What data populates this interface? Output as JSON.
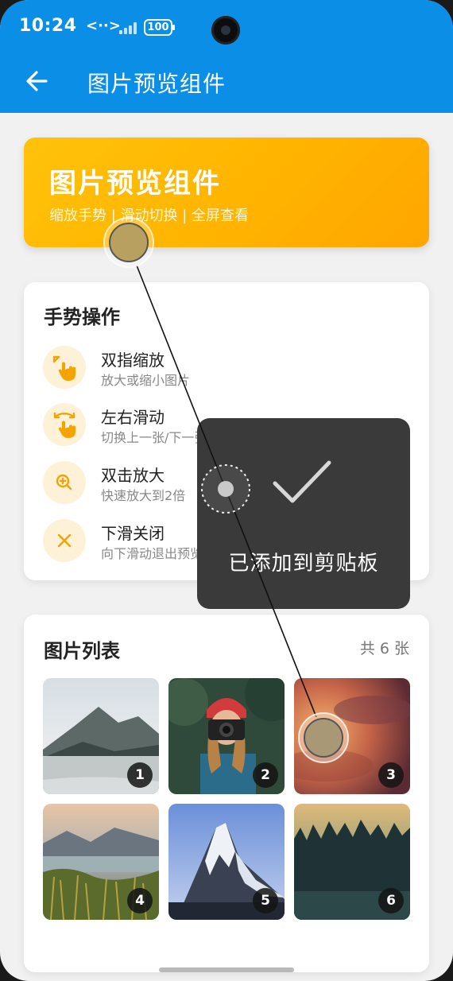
{
  "status_bar": {
    "time": "10:24",
    "network": "<··>",
    "battery": "100"
  },
  "app_bar": {
    "back_icon": "arrow-left-icon",
    "title": "图片预览组件"
  },
  "banner": {
    "title": "图片预览组件",
    "subtitle": "缩放手势 | 滑动切换 | 全屏查看"
  },
  "gestures": {
    "title": "手势操作",
    "items": [
      {
        "icon": "pinch-zoom-icon",
        "name": "双指缩放",
        "desc": "放大或缩小图片"
      },
      {
        "icon": "swipe-icon",
        "name": "左右滑动",
        "desc": "切换上一张/下一张"
      },
      {
        "icon": "zoom-in-icon",
        "name": "双击放大",
        "desc": "快速放大到2倍"
      },
      {
        "icon": "close-icon",
        "name": "下滑关闭",
        "desc": "向下滑动退出预览"
      }
    ]
  },
  "image_list": {
    "title": "图片列表",
    "count": "共 6 张",
    "images": [
      {
        "index": "1"
      },
      {
        "index": "2"
      },
      {
        "index": "3"
      },
      {
        "index": "4"
      },
      {
        "index": "5"
      },
      {
        "index": "6"
      }
    ]
  },
  "toast": {
    "text": "已添加到剪贴板",
    "icon": "check-icon"
  },
  "colors": {
    "app_bar": "#0a8ee6",
    "accent": "#ffb300",
    "toast_bg": "#3a3a3a"
  }
}
